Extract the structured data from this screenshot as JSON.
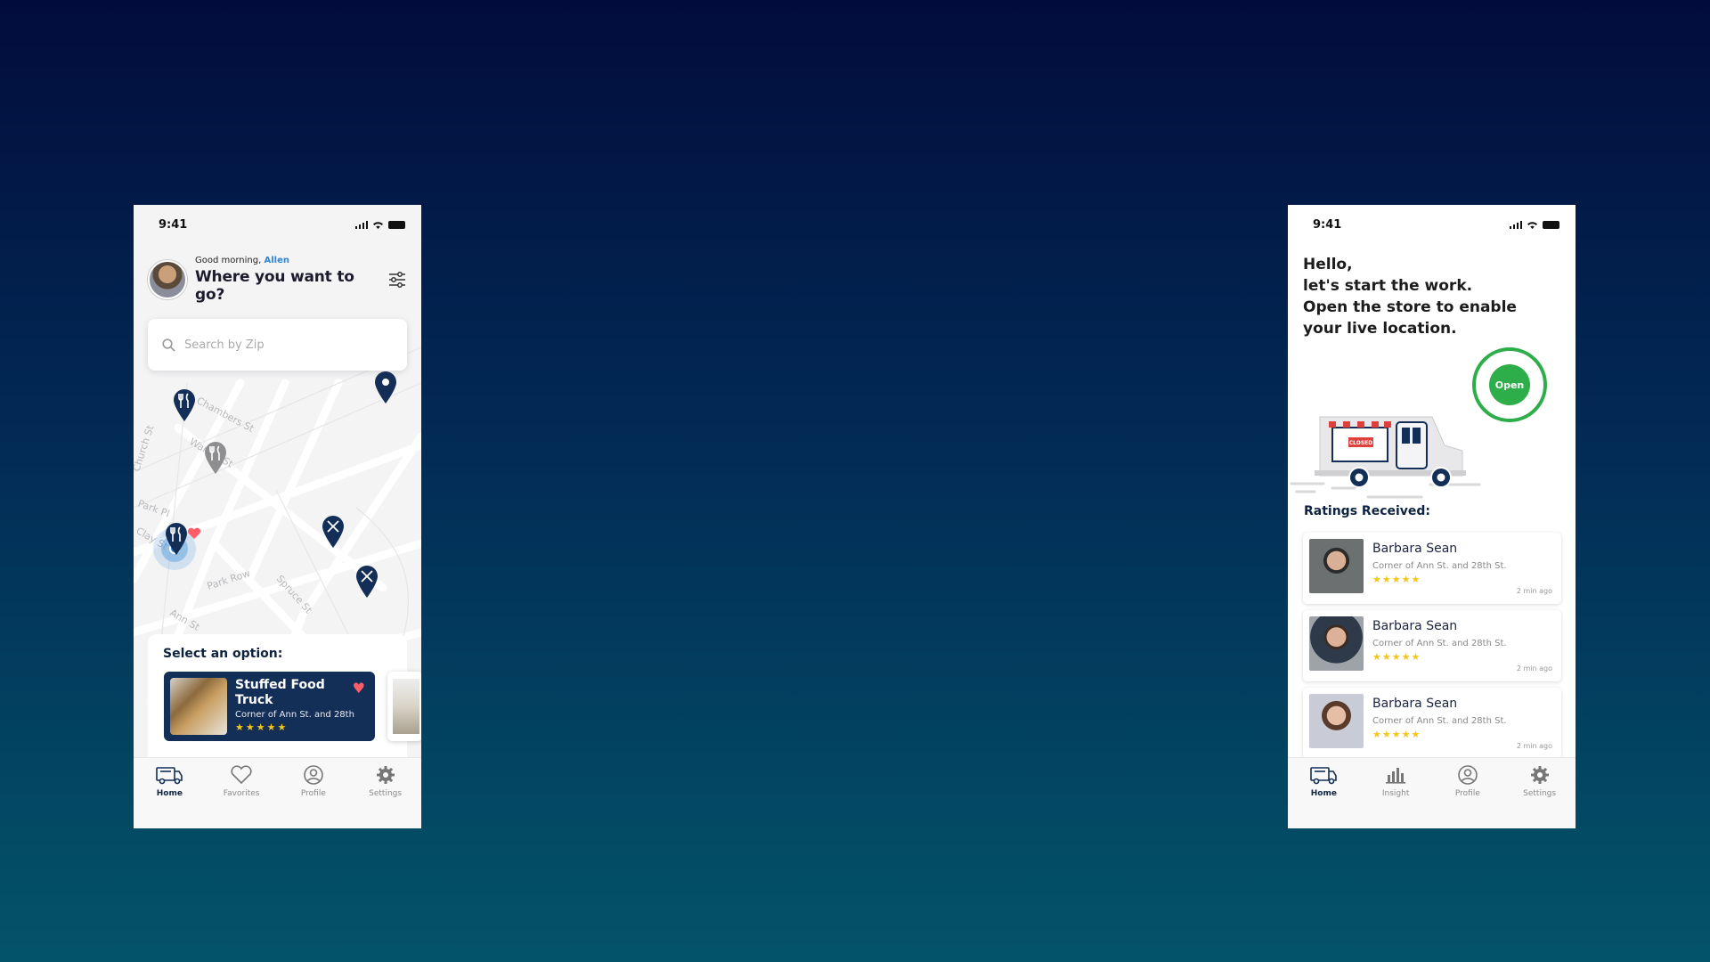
{
  "colors": {
    "navy": "#132e57",
    "accent_blue": "#2c86d9",
    "open_green": "#2eae4a",
    "star_yellow": "#f5c518",
    "heart_red": "#ff5d6a"
  },
  "left_phone": {
    "status_time": "9:41",
    "greeting_prefix": "Good morning,",
    "user_name": "Allen",
    "title": "Where you want to go?",
    "search_placeholder": "Search by Zip",
    "map_streets": [
      "Chambers St",
      "Warren St",
      "Church St",
      "Park Pl",
      "Park Row",
      "Spruce St",
      "Ann St",
      "Clay St"
    ],
    "option_title": "Select an option:",
    "selected_truck": {
      "name": "Stuffed Food Truck",
      "address": "Corner of Ann St. and 28th",
      "rating": 5
    },
    "nav": [
      {
        "label": "Home",
        "icon": "truck-icon",
        "active": true
      },
      {
        "label": "Favorites",
        "icon": "heart-icon",
        "active": false
      },
      {
        "label": "Profile",
        "icon": "profile-icon",
        "active": false
      },
      {
        "label": "Settings",
        "icon": "gear-icon",
        "active": false
      }
    ]
  },
  "right_phone": {
    "status_time": "9:41",
    "hello_lines": [
      "Hello,",
      "let's start the work.",
      "Open the store to enable",
      "your live location."
    ],
    "open_label": "Open",
    "truck_sign": "CLOSED",
    "ratings_title": "Ratings Received:",
    "ratings": [
      {
        "name": "Barbara Sean",
        "address": "Corner of Ann St. and 28th St.",
        "time": "2 min ago",
        "stars": 5
      },
      {
        "name": "Barbara Sean",
        "address": "Corner of Ann St. and 28th St.",
        "time": "2 min ago",
        "stars": 5
      },
      {
        "name": "Barbara Sean",
        "address": "Corner of Ann St. and 28th St.",
        "time": "2 min ago",
        "stars": 5
      }
    ],
    "nav": [
      {
        "label": "Home",
        "icon": "truck-icon",
        "active": true
      },
      {
        "label": "Insight",
        "icon": "bar-chart-icon",
        "active": false
      },
      {
        "label": "Profile",
        "icon": "profile-icon",
        "active": false
      },
      {
        "label": "Settings",
        "icon": "gear-icon",
        "active": false
      }
    ]
  }
}
